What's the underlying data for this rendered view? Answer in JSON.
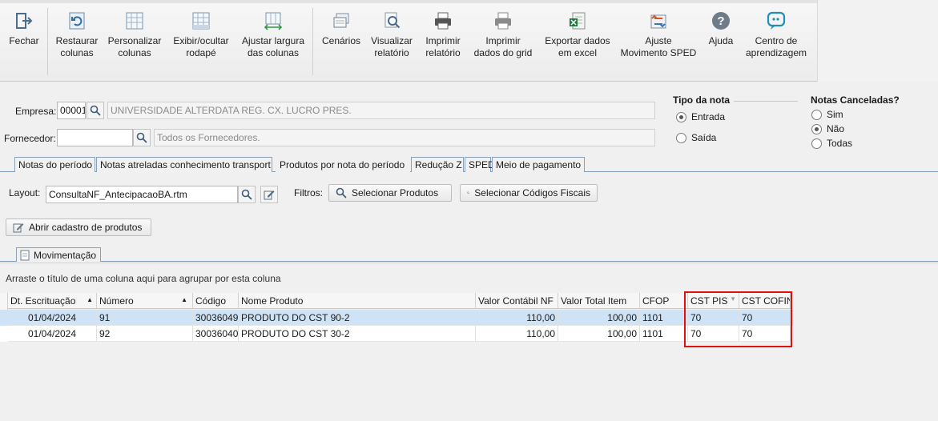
{
  "toolbar": {
    "fechar": "Fechar",
    "restaurar_l1": "Restaurar",
    "restaurar_l2": "colunas",
    "personalizar_l1": "Personalizar",
    "personalizar_l2": "colunas",
    "exibir_l1": "Exibir/ocultar",
    "exibir_l2": "rodapé",
    "ajustar_l1": "Ajustar largura",
    "ajustar_l2": "das colunas",
    "cenarios": "Cenários",
    "visualizar_l1": "Visualizar",
    "visualizar_l2": "relatório",
    "imprimir_rel_l1": "Imprimir",
    "imprimir_rel_l2": "relatório",
    "imprimir_grid_l1": "Imprimir",
    "imprimir_grid_l2": "dados do grid",
    "exportar_l1": "Exportar dados",
    "exportar_l2": "em excel",
    "ajuste_sped_l1": "Ajuste",
    "ajuste_sped_l2": "Movimento SPED",
    "ajuda": "Ajuda",
    "centro_l1": "Centro de",
    "centro_l2": "aprendizagem"
  },
  "filters": {
    "empresa_label": "Empresa:",
    "empresa_code": "00001",
    "empresa_name": "UNIVERSIDADE ALTERDATA REG. CX. LUCRO PRES.",
    "fornecedor_label": "Fornecedor:",
    "fornecedor_code": "",
    "fornecedor_name": "Todos os Fornecedores.",
    "tipo_nota_title": "Tipo da nota",
    "tipo_nota_options": [
      "Entrada",
      "Saída"
    ],
    "tipo_nota_selected": "Entrada",
    "canceladas_title": "Notas Canceladas?",
    "canceladas_options": [
      "Sim",
      "Não",
      "Todas"
    ],
    "canceladas_selected": "Não"
  },
  "tabs": [
    "Notas do período",
    "Notas atreladas conhecimento transport",
    "Produtos por nota do período",
    "Redução Z",
    "SPED",
    "Meio de pagamento"
  ],
  "active_tab": "Produtos por nota do período",
  "layout": {
    "label": "Layout:",
    "value": "ConsultaNF_AntecipacaoBA.rtm",
    "filtros_label": "Filtros:",
    "selecionar_produtos": "Selecionar Produtos",
    "selecionar_codigos": "Selecionar Códigos Fiscais",
    "abrir_cadastro": "Abrir cadastro de produtos"
  },
  "subtab": "Movimentação",
  "group_hint": "Arraste o título de uma coluna aqui para agrupar por esta coluna",
  "grid": {
    "columns": [
      "Dt. Escrituação",
      "Número",
      "Código",
      "Nome Produto",
      "Valor Contábil NF",
      "Valor Total Item",
      "CFOP",
      "CST PIS",
      "CST COFIN"
    ],
    "rows": [
      [
        "01/04/2024",
        "91",
        "30036049",
        "PRODUTO DO CST 90-2",
        "110,00",
        "100,00",
        "1101",
        "70",
        "70"
      ],
      [
        "01/04/2024",
        "92",
        "30036040",
        "PRODUTO DO CST 30-2",
        "110,00",
        "100,00",
        "1101",
        "70",
        "70"
      ]
    ]
  }
}
